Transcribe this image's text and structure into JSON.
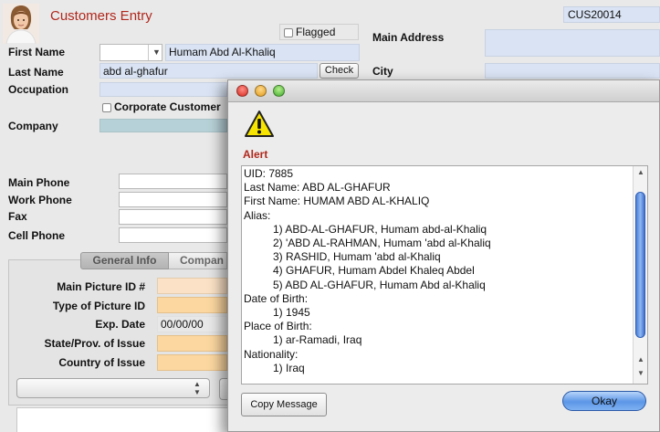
{
  "window": {
    "title": "Customers Entry",
    "record_id": "CUS20014"
  },
  "form": {
    "flagged_label": "Flagged",
    "first_name_label": "First Name",
    "first_name_value": "Humam Abd Al-Khaliq",
    "last_name_label": "Last Name",
    "last_name_value": "abd al-ghafur",
    "check_button": "Check",
    "occupation_label": "Occupation",
    "corporate_label": "Corporate Customer",
    "company_label": "Company",
    "main_address_label": "Main Address",
    "city_label": "City",
    "main_phone_label": "Main Phone",
    "work_phone_label": "Work Phone",
    "fax_label": "Fax",
    "cell_phone_label": "Cell Phone"
  },
  "tabs": [
    {
      "label": "General Info"
    },
    {
      "label": "Compan"
    }
  ],
  "id_section": {
    "main_picture_id_label": "Main Picture ID #",
    "type_of_picture_id_label": "Type of Picture ID",
    "exp_date_label": "Exp. Date",
    "exp_date_value": "00/00/00",
    "state_label": "State/Prov. of Issue",
    "country_label": "Country of Issue"
  },
  "dialog": {
    "heading": "Alert",
    "lines": [
      {
        "text": "UID: 7885",
        "indent": false
      },
      {
        "text": "Last Name: ABD AL-GHAFUR",
        "indent": false
      },
      {
        "text": "First Name: HUMAM ABD AL-KHALIQ",
        "indent": false
      },
      {
        "text": "Alias:",
        "indent": false
      },
      {
        "text": "1) ABD-AL-GHAFUR, Humam abd-al-Khaliq",
        "indent": true
      },
      {
        "text": "2) 'ABD AL-RAHMAN, Humam 'abd al-Khaliq",
        "indent": true
      },
      {
        "text": "3) RASHID, Humam 'abd al-Khaliq",
        "indent": true
      },
      {
        "text": "4) GHAFUR, Humam Abdel Khaleq Abdel",
        "indent": true
      },
      {
        "text": "5) ABD AL-GHAFUR, Humam Abd al-Khaliq",
        "indent": true
      },
      {
        "text": "Date of Birth:",
        "indent": false
      },
      {
        "text": "1) 1945",
        "indent": true
      },
      {
        "text": "Place of Birth:",
        "indent": false
      },
      {
        "text": "1) ar-Ramadi, Iraq",
        "indent": true
      },
      {
        "text": "Nationality:",
        "indent": false
      },
      {
        "text": "1) Iraq",
        "indent": true
      }
    ],
    "copy_button": "Copy Message",
    "ok_button": "Okay"
  },
  "colors": {
    "title_red": "#b1271b",
    "alert_red": "#b1271b",
    "field_blue": "#d9e3f3",
    "field_teal": "#b7d1d8",
    "field_peach": "#fbe2c6",
    "field_orange": "#fcd7a0"
  },
  "icons": [
    "avatar-photo",
    "warning-triangle-icon",
    "dropdown-arrow-icon",
    "stepper-arrows-icon"
  ]
}
